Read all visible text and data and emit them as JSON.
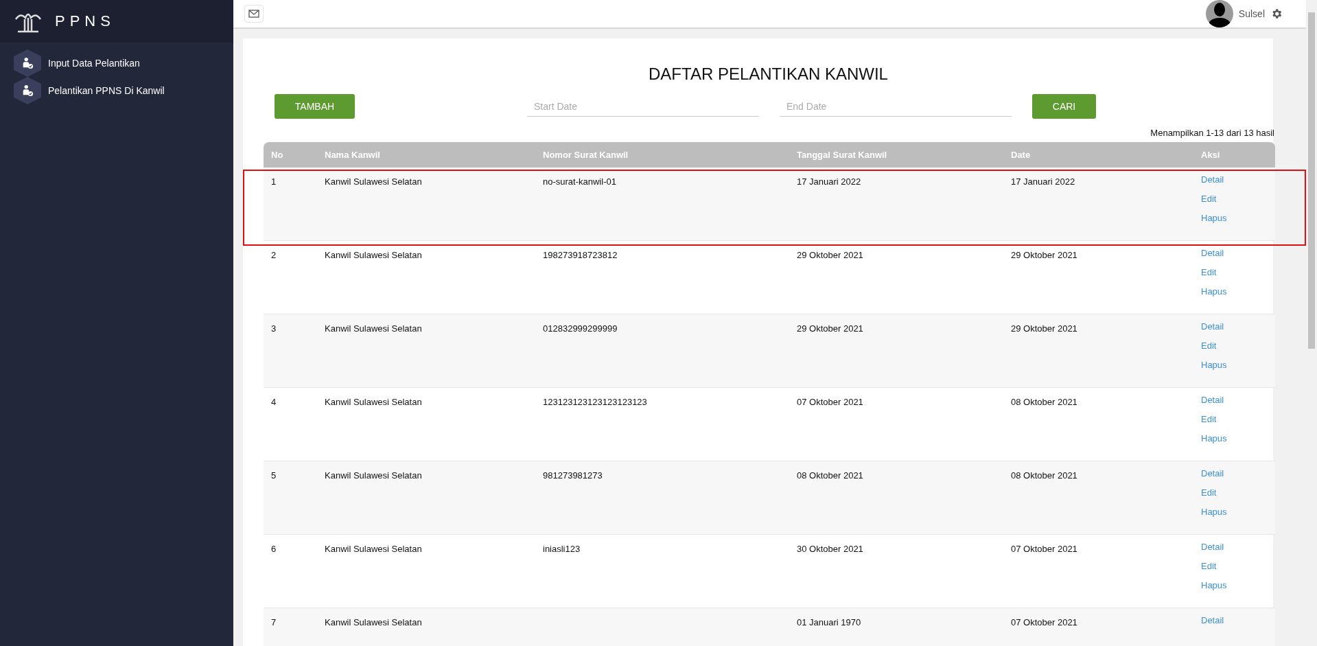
{
  "sidebar": {
    "brand": "PPNS",
    "items": [
      {
        "label": "Input Data Pelantikan"
      },
      {
        "label": "Pelantikan PPNS Di Kanwil"
      }
    ]
  },
  "header": {
    "user": "Sulsel"
  },
  "page": {
    "title": "DAFTAR PELANTIKAN KANWIL",
    "add_button": "TAMBAH",
    "start_date": {
      "placeholder": "Start Date"
    },
    "end_date": {
      "placeholder": "End Date"
    },
    "search_button": "CARI",
    "summary": "Menampilkan 1-13 dari 13 hasil"
  },
  "table": {
    "columns": [
      "No",
      "Nama Kanwil",
      "Nomor Surat Kanwil",
      "Tanggal Surat Kanwil",
      "Date",
      "Aksi"
    ],
    "rows": [
      {
        "cells": [
          "1",
          "Kanwil Sulawesi Selatan",
          "no-surat-kanwil-01",
          "17 Januari 2022",
          "17 Januari 2022"
        ],
        "actions": [
          "Detail",
          "Edit",
          "Hapus"
        ],
        "highlighted": true
      },
      {
        "cells": [
          "2",
          "Kanwil Sulawesi Selatan",
          "198273918723812",
          "29 Oktober 2021",
          "29 Oktober 2021"
        ],
        "actions": [
          "Detail",
          "Edit",
          "Hapus"
        ],
        "highlighted": false
      },
      {
        "cells": [
          "3",
          "Kanwil Sulawesi Selatan",
          "012832999299999",
          "29 Oktober 2021",
          "29 Oktober 2021"
        ],
        "actions": [
          "Detail",
          "Edit",
          "Hapus"
        ],
        "highlighted": false
      },
      {
        "cells": [
          "4",
          "Kanwil Sulawesi Selatan",
          "123123123123123123123",
          "07 Oktober 2021",
          "08 Oktober 2021"
        ],
        "actions": [
          "Detail",
          "Edit",
          "Hapus"
        ],
        "highlighted": false
      },
      {
        "cells": [
          "5",
          "Kanwil Sulawesi Selatan",
          "981273981273",
          "08 Oktober 2021",
          "08 Oktober 2021"
        ],
        "actions": [
          "Detail",
          "Edit",
          "Hapus"
        ],
        "highlighted": false
      },
      {
        "cells": [
          "6",
          "Kanwil Sulawesi Selatan",
          "iniasli123",
          "30 Oktober 2021",
          "07 Oktober 2021"
        ],
        "actions": [
          "Detail",
          "Edit",
          "Hapus"
        ],
        "highlighted": false
      },
      {
        "cells": [
          "7",
          "Kanwil Sulawesi Selatan",
          "",
          "01 Januari 1970",
          "07 Oktober 2021"
        ],
        "actions": [
          "Detail"
        ],
        "highlighted": false
      }
    ]
  }
}
